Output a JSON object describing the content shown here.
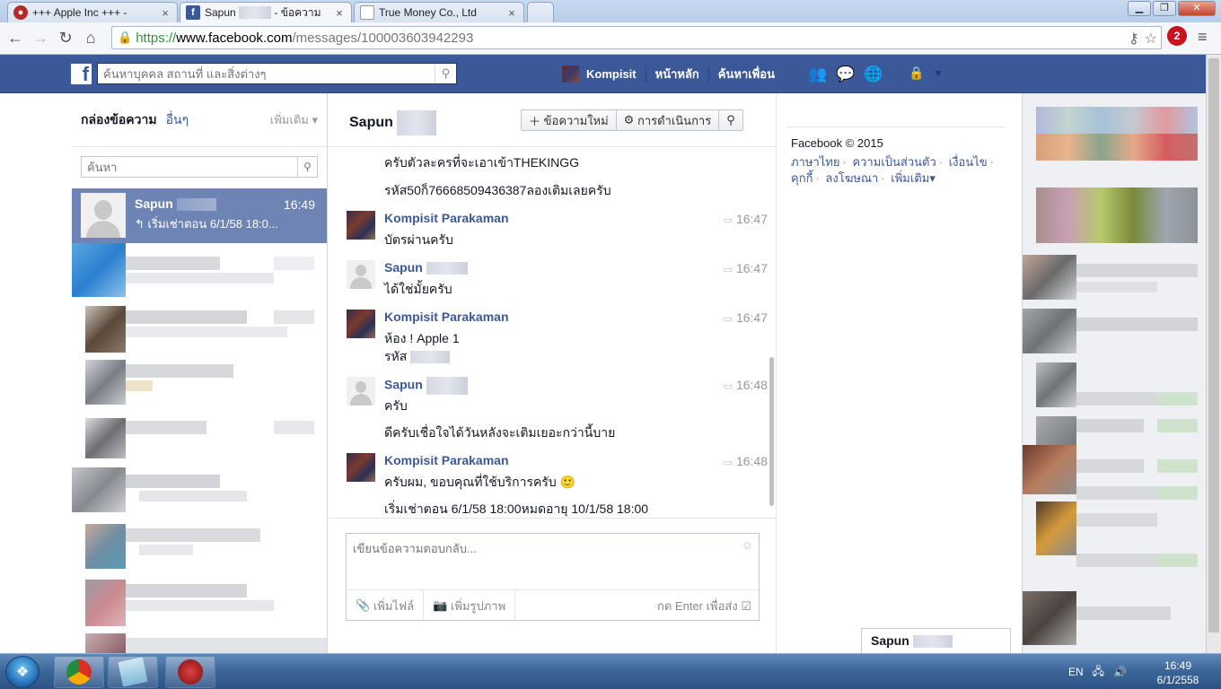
{
  "browser": {
    "tabs": [
      {
        "title": "+++ Apple Inc +++ -",
        "icon": "app-icon"
      },
      {
        "title": "Sapun",
        "suffix": "- ข้อความ",
        "icon": "facebook-icon"
      },
      {
        "title": "True Money Co., Ltd",
        "icon": "page-icon"
      }
    ],
    "url": {
      "scheme": "https://",
      "host": "www.facebook.com",
      "path": "/messages/100003603942293"
    },
    "extension_badge": "2"
  },
  "fb_header": {
    "search_placeholder": "ค้นหาบุคคล สถานที่ และสิ่งต่างๆ",
    "profile_name": "Kompisit",
    "home": "หน้าหลัก",
    "find_friends": "ค้นหาเพื่อน"
  },
  "left": {
    "inbox": "กล่องข้อความ",
    "other": "อื่นๆ",
    "more": "เพิ่มเติม",
    "search_placeholder": "ค้นหา",
    "active_conversation": {
      "name": "Sapun",
      "time": "16:49",
      "snippet": "เริ่มเช่าตอน 6/1/58 18:0..."
    }
  },
  "thread": {
    "title": "Sapun",
    "new_message": "ข้อความใหม่",
    "actions": "การดำเนินการ",
    "lines": [
      "ครับตัวละครที่จะเอาเข้าTHEKINGG",
      "รหัส50ก็76668509436387ลองเติมเลยครับ"
    ],
    "messages": [
      {
        "sender": "Kompisit Parakaman",
        "time": "16:47",
        "lines": [
          "บัตรผ่านครับ"
        ]
      },
      {
        "sender": "Sapun",
        "time": "16:47",
        "lines": [
          "ได้ใช่มั้ยครับ"
        ]
      },
      {
        "sender": "Kompisit Parakaman",
        "time": "16:47",
        "lines": [
          "ห้อง ! Apple 1",
          "รหัส"
        ]
      },
      {
        "sender": "Sapun",
        "time": "16:48",
        "lines": [
          "ครับ",
          "ดีครับเชื่อใจได้วันหลังจะเติมเยอะกว่านี้บาย"
        ]
      },
      {
        "sender": "Kompisit Parakaman",
        "time": "16:48",
        "lines": [
          "ครับผม, ขอบคุณที่ใช้บริการครับ 🙂",
          "เริ่มเช่าตอน 6/1/58 18:00หมดอายุ 10/1/58 18:00"
        ]
      }
    ],
    "composer": {
      "placeholder": "เขียนข้อความตอบกลับ...",
      "attach": "เพิ่มไฟล์",
      "photo": "เพิ่มรูปภาพ",
      "enter_to_send": "กด Enter เพื่อส่ง"
    }
  },
  "rail": {
    "copyright": "Facebook © 2015",
    "links": [
      "ภาษาไทย",
      "ความเป็นส่วนตัว",
      "เงื่อนไข",
      "คุกกี้",
      "ลงโฆษณา",
      "เพิ่มเติม"
    ]
  },
  "chat_tab": {
    "name": "Sapun"
  },
  "taskbar": {
    "lang": "EN",
    "time": "16:49",
    "date": "6/1/2558"
  }
}
